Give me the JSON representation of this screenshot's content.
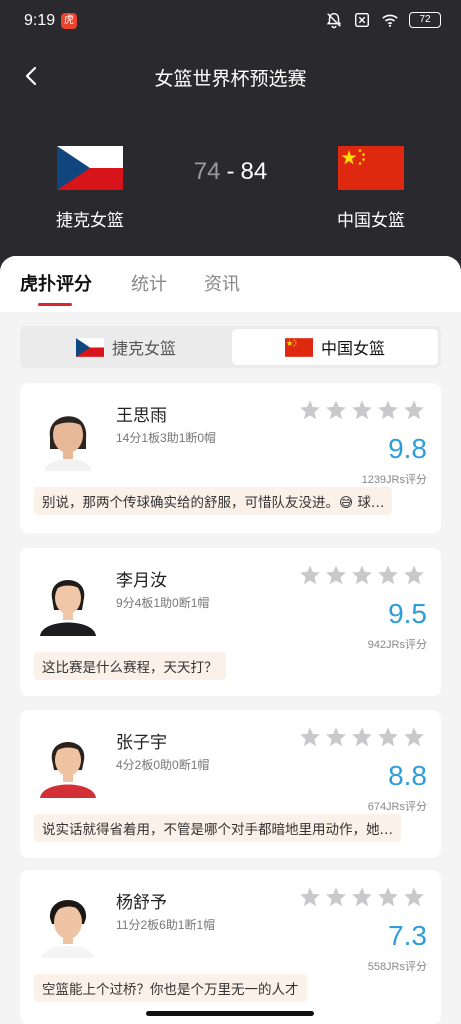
{
  "status_bar": {
    "time": "9:19",
    "battery": "72",
    "app_icon_text": "虎"
  },
  "header": {
    "title": "女篮世界杯预选赛",
    "home_team": "捷克女篮",
    "away_team": "中国女篮",
    "home_score": "74",
    "separator": "-",
    "away_score": "84"
  },
  "tabs": [
    {
      "label": "虎扑评分",
      "active": true
    },
    {
      "label": "统计",
      "active": false
    },
    {
      "label": "资讯",
      "active": false
    }
  ],
  "team_toggle": {
    "left_label": "捷克女篮",
    "right_label": "中国女篮",
    "selected": "中国女篮"
  },
  "players": [
    {
      "name": "王思雨",
      "stats": "14分1板3助1断0帽",
      "rating": "9.8",
      "votes": "1239JRs评分",
      "comment": "别说，那两个传球确实给的舒服，可惜队友没进。😅 球…",
      "stars": 0
    },
    {
      "name": "李月汝",
      "stats": "9分4板1助0断1帽",
      "rating": "9.5",
      "votes": "942JRs评分",
      "comment": "这比赛是什么赛程，天天打？",
      "stars": 0
    },
    {
      "name": "张子宇",
      "stats": "4分2板0助0断1帽",
      "rating": "8.8",
      "votes": "674JRs评分",
      "comment": "说实话就得省着用，不管是哪个对手都暗地里用动作，她…",
      "stars": 0
    },
    {
      "name": "杨舒予",
      "stats": "11分2板6助1断1帽",
      "rating": "7.3",
      "votes": "558JRs评分",
      "comment": "空篮能上个过桥？你也是个万里无一的人才",
      "stars": 0
    }
  ],
  "colors": {
    "header_bg": "#2a2a2e",
    "accent_red": "#d8252e",
    "rating_blue": "#2f9ed8",
    "comment_bg": "#fbf1e8",
    "star_gray": "#c9c9cc"
  },
  "icons": [
    "back-arrow-icon",
    "mute-bell-icon",
    "no-sim-icon",
    "wifi-icon",
    "battery-icon",
    "star-icon"
  ]
}
